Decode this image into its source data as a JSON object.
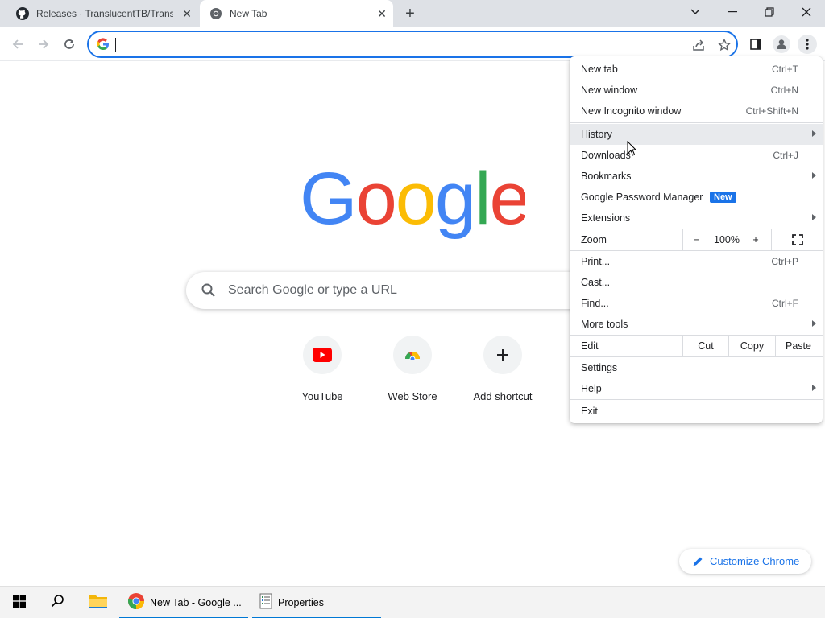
{
  "tabs": [
    {
      "title": "Releases · TranslucentTB/Translu",
      "icon": "github-icon"
    },
    {
      "title": "New Tab",
      "icon": "chrome-icon"
    }
  ],
  "omnibox": {
    "value": "",
    "placeholder": ""
  },
  "page": {
    "search_placeholder": "Search Google or type a URL",
    "shortcuts": [
      {
        "label": "YouTube",
        "icon": "youtube-icon"
      },
      {
        "label": "Web Store",
        "icon": "web-store-icon"
      },
      {
        "label": "Add shortcut",
        "icon": "plus-icon"
      }
    ],
    "customize_label": "Customize Chrome"
  },
  "menu": {
    "new_tab": {
      "label": "New tab",
      "shortcut": "Ctrl+T"
    },
    "new_window": {
      "label": "New window",
      "shortcut": "Ctrl+N"
    },
    "new_incognito": {
      "label": "New Incognito window",
      "shortcut": "Ctrl+Shift+N"
    },
    "history": {
      "label": "History"
    },
    "downloads": {
      "label": "Downloads",
      "shortcut": "Ctrl+J"
    },
    "bookmarks": {
      "label": "Bookmarks"
    },
    "password_manager": {
      "label": "Google Password Manager",
      "badge": "New"
    },
    "extensions": {
      "label": "Extensions"
    },
    "zoom": {
      "label": "Zoom",
      "minus": "−",
      "level": "100%",
      "plus": "+"
    },
    "print": {
      "label": "Print...",
      "shortcut": "Ctrl+P"
    },
    "cast": {
      "label": "Cast..."
    },
    "find": {
      "label": "Find...",
      "shortcut": "Ctrl+F"
    },
    "more_tools": {
      "label": "More tools"
    },
    "edit": {
      "label": "Edit",
      "cut": "Cut",
      "copy": "Copy",
      "paste": "Paste"
    },
    "settings": {
      "label": "Settings"
    },
    "help": {
      "label": "Help"
    },
    "exit": {
      "label": "Exit"
    }
  },
  "taskbar": {
    "items": [
      {
        "label": "New Tab - Google ...",
        "icon": "chrome-icon"
      },
      {
        "label": "Properties",
        "icon": "properties-icon"
      }
    ]
  },
  "colors": {
    "accent": "#1a73e8",
    "tabstrip": "#dee1e6",
    "google_blue": "#4285f4",
    "google_red": "#ea4335",
    "google_yellow": "#fbbc05",
    "google_green": "#34a853"
  }
}
